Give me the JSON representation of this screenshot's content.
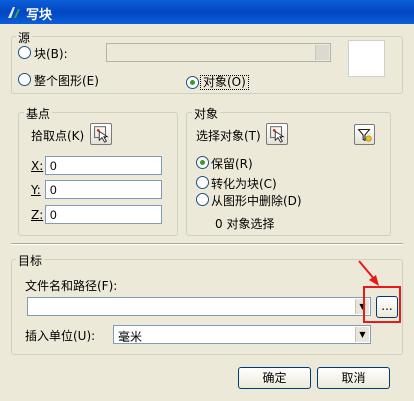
{
  "window": {
    "title": "写块"
  },
  "source": {
    "label": "源",
    "block_option": "块(B):",
    "entire_drawing_option": "整个图形(E)",
    "objects_option": "对象(O)"
  },
  "base_point": {
    "label": "基点",
    "pick_label": "拾取点(K)",
    "x_label": "X:",
    "x_value": "0",
    "y_label": "Y:",
    "y_value": "0",
    "z_label": "Z:",
    "z_value": "0"
  },
  "objects": {
    "label": "对象",
    "select_label": "选择对象(T)",
    "retain_option": "保留(R)",
    "convert_option": "转化为块(C)",
    "delete_option": "从图形中删除(D)",
    "status": "0 对象选择"
  },
  "destination": {
    "label": "目标",
    "filename_label": "文件名和路径(F):",
    "filename_value": "",
    "browse_label": "...",
    "units_label": "插入单位(U):",
    "units_value": "毫米"
  },
  "buttons": {
    "ok": "确定",
    "cancel": "取消"
  },
  "colors": {
    "titlebar": "#0a5fd8",
    "annotation": "#e51b1b",
    "dialog_bg": "#ece9d8"
  }
}
